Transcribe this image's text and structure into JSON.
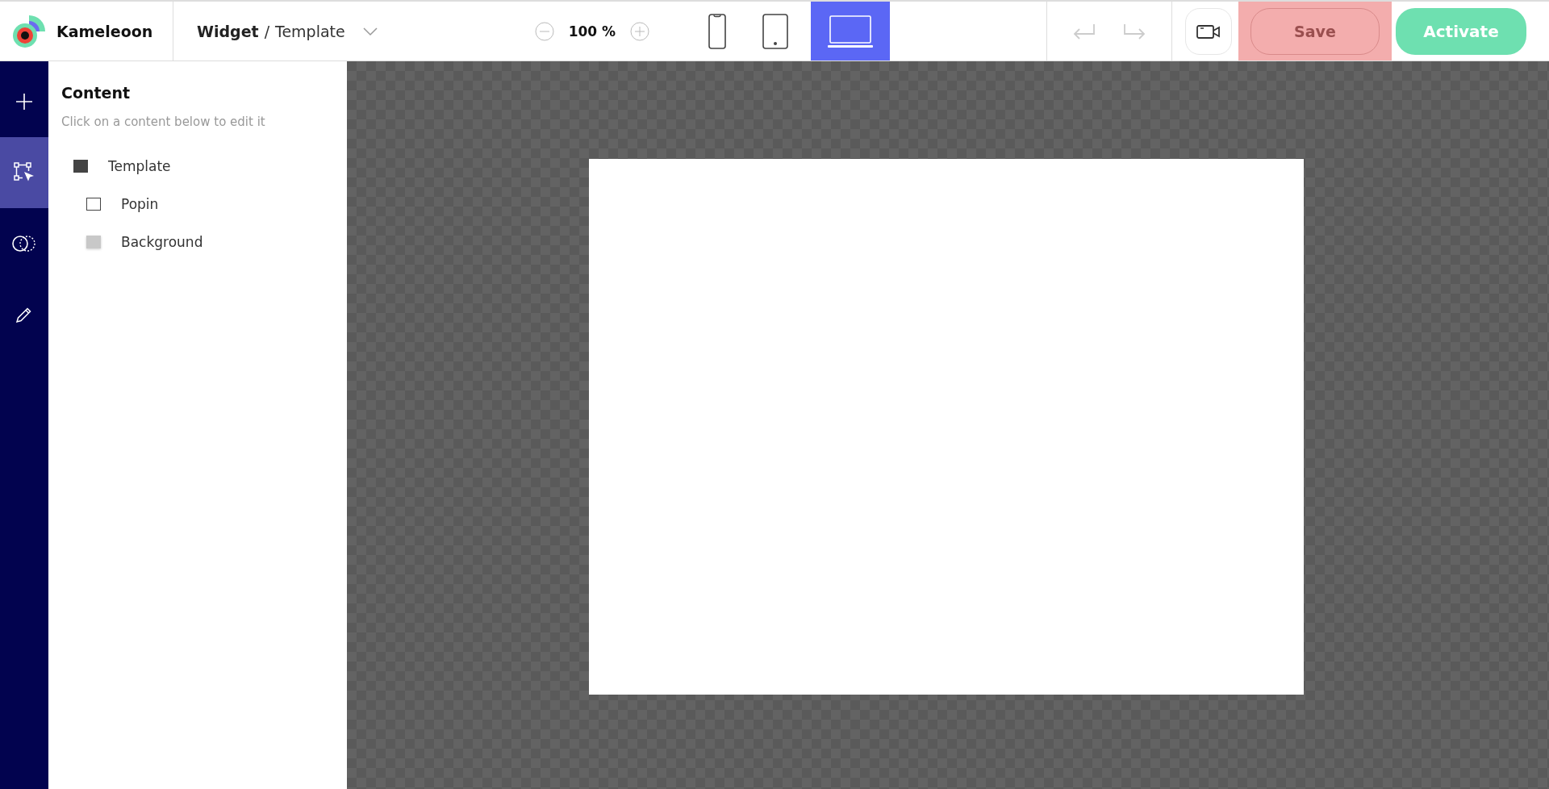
{
  "brand": {
    "name": "Kameleoon"
  },
  "breadcrumb": {
    "parent": "Widget",
    "separator": "/",
    "current": "Template"
  },
  "zoom": {
    "value": "100 %"
  },
  "devices": [
    {
      "kind": "phone",
      "selected": false
    },
    {
      "kind": "tablet",
      "selected": false
    },
    {
      "kind": "laptop",
      "selected": true
    }
  ],
  "history": [
    {
      "kind": "undo",
      "disabled": true
    },
    {
      "kind": "redo",
      "disabled": true
    }
  ],
  "save": {
    "label": "Save",
    "disabled": true,
    "highlighted": true
  },
  "activate": {
    "label": "Activate"
  },
  "rail": [
    {
      "kind": "add",
      "selected": false
    },
    {
      "kind": "select",
      "selected": true
    },
    {
      "kind": "shapes",
      "selected": false
    },
    {
      "kind": "edit",
      "selected": false
    }
  ],
  "panel": {
    "title": "Content",
    "hint": "Click on a content below to edit it",
    "tree": [
      {
        "label": "Template",
        "kind": "solid",
        "children": [
          {
            "label": "Popin",
            "kind": "outline"
          },
          {
            "label": "Background",
            "kind": "shade"
          }
        ]
      }
    ]
  }
}
